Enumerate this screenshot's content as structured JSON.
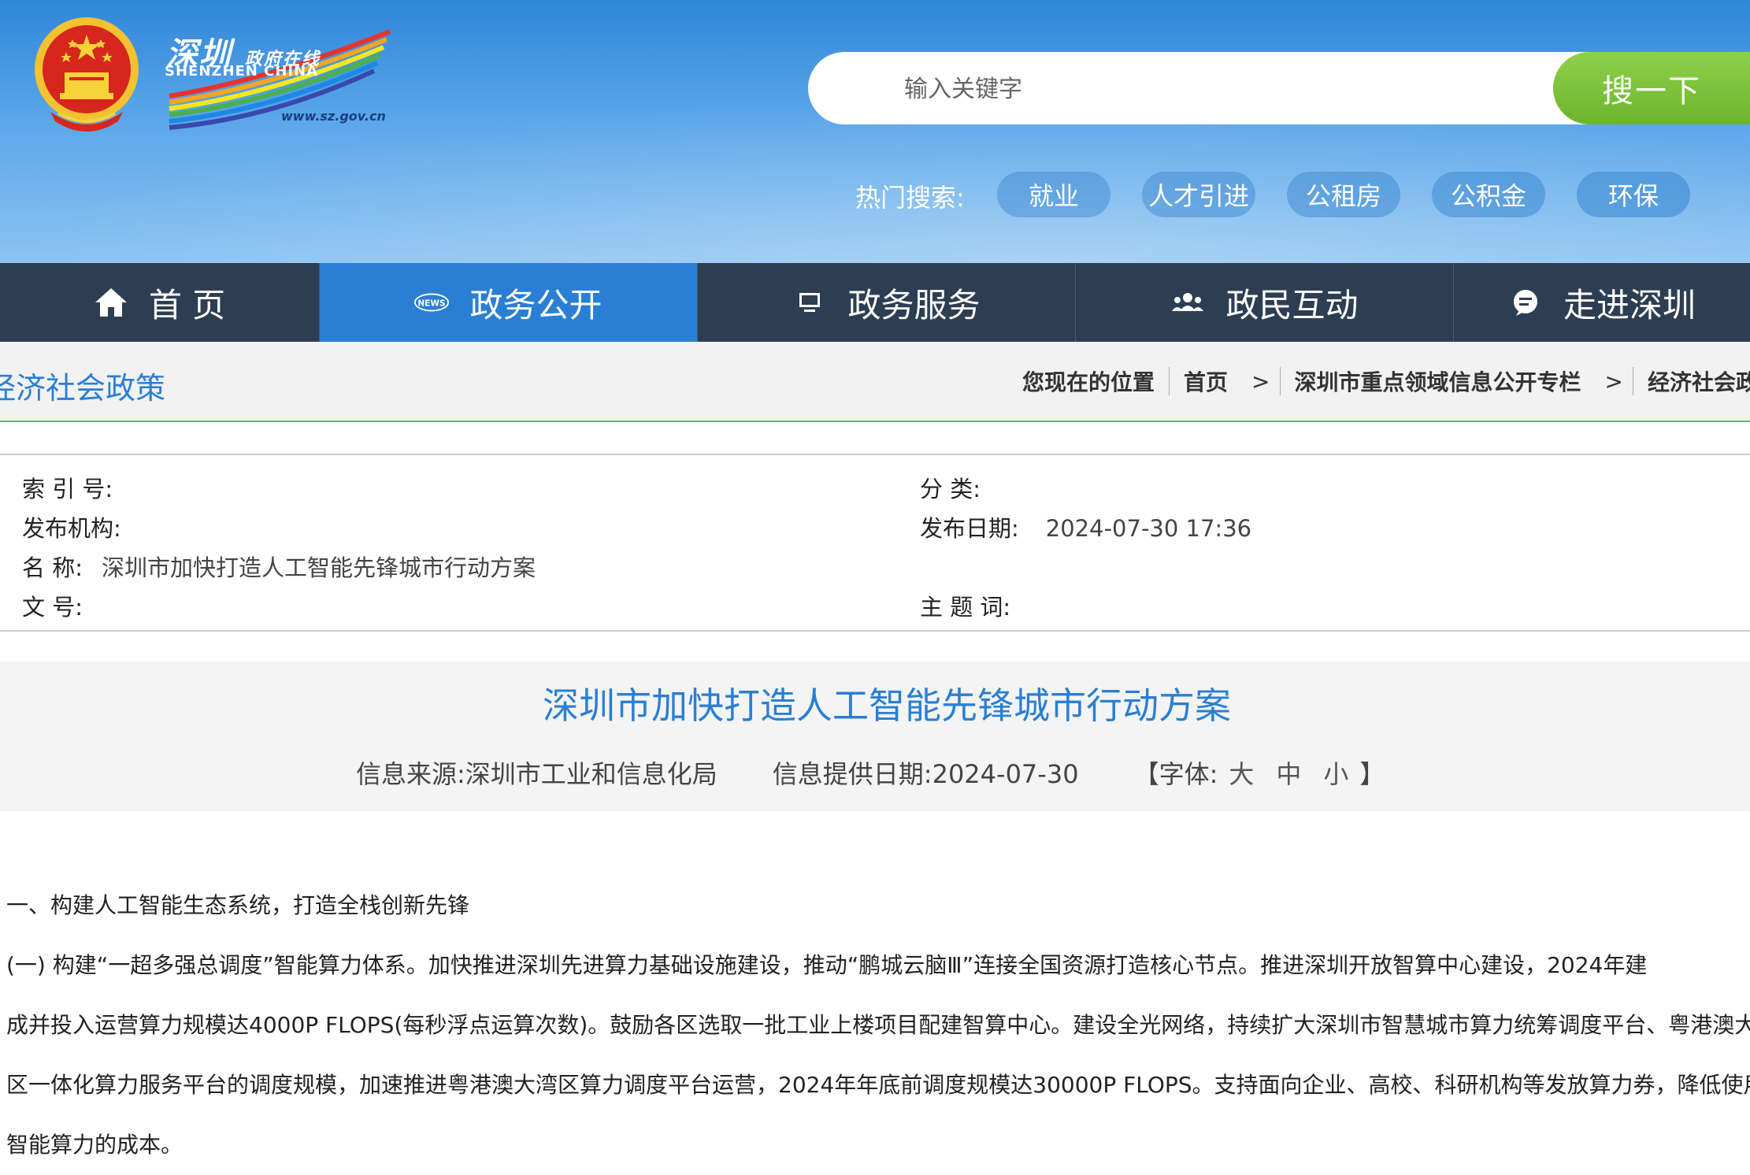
{
  "header": {
    "logo_cn_main": "深圳",
    "logo_cn_sub": "政府在线",
    "logo_en": "SHENZHEN  CHINA",
    "logo_url": "www.sz.gov.cn",
    "search": {
      "placeholder": "输入关键字",
      "button_label": "搜一下"
    },
    "hot_search": {
      "label": "热门搜索:",
      "tags": [
        "就业",
        "人才引进",
        "公租房",
        "公积金",
        "环保"
      ]
    }
  },
  "nav": {
    "items": [
      {
        "label": "首 页",
        "icon": "home-icon"
      },
      {
        "label": "政务公开",
        "icon": "news-icon"
      },
      {
        "label": "政务服务",
        "icon": "monitor-icon"
      },
      {
        "label": "政民互动",
        "icon": "people-icon"
      },
      {
        "label": "走进深圳",
        "icon": "chat-icon"
      }
    ],
    "active_index": 1
  },
  "breadcrumb": {
    "section_title": "经济社会政策",
    "location_label": "您现在的位置",
    "items": [
      "首页",
      "深圳市重点领域信息公开专栏",
      "经济社会政策"
    ],
    "separator": ">"
  },
  "meta": {
    "index_label": "索 引 号:",
    "index_value": "",
    "category_label": "分    类:",
    "category_value": "",
    "publisher_label": "发布机构:",
    "publisher_value": "",
    "date_label": "发布日期:",
    "date_value": "2024-07-30 17:36",
    "name_label": "名    称:",
    "name_value": "深圳市加快打造人工智能先锋城市行动方案",
    "docno_label": "文    号:",
    "docno_value": "",
    "topic_label": "主 题 词:",
    "topic_value": ""
  },
  "article": {
    "title": "深圳市加快打造人工智能先锋城市行动方案",
    "source": "信息来源:深圳市工业和信息化局",
    "provide_date": "信息提供日期:2024-07-30",
    "font_label_open": "【字体:",
    "font_sizes": [
      "大",
      "中",
      "小"
    ],
    "font_label_close": "】",
    "paragraphs": [
      "   一、构建人工智能生态系统，打造全栈创新先锋",
      "    (一) 构建“一超多强总调度”智能算力体系。加快推进深圳先进算力基础设施建设，推动“鹏城云脑Ⅲ”连接全国资源打造核心节点。推进深圳开放智算中心建设，2024年建",
      "成并投入运营算力规模达4000P FLOPS(每秒浮点运算次数)。鼓励各区选取一批工业上楼项目配建智算中心。建设全光网络，持续扩大深圳市智慧城市算力统筹调度平台、粤港澳大湾",
      "区一体化算力服务平台的调度规模，加速推进粤港澳大湾区算力调度平台运营，2024年年底前调度规模达30000P FLOPS。支持面向企业、高校、科研机构等发放算力券，降低使用",
      "智能算力的成本。"
    ]
  },
  "colors": {
    "banner_top": "#2f86d8",
    "nav_bg": "#2d3e52",
    "nav_active": "#2a7fd4",
    "search_button": "#7cc23a",
    "title_blue": "#2a7fd4",
    "breadcrumb_rule": "#6cbf4a"
  }
}
